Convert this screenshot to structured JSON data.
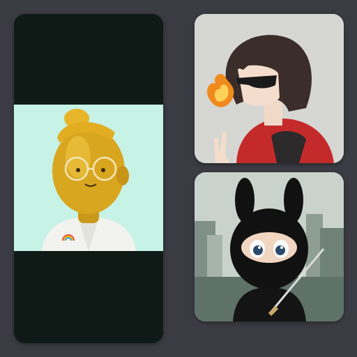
{
  "gallery": {
    "background": "#3b3b43",
    "items": [
      {
        "subject": "golden-character-with-glasses",
        "panel_color": "#c7f2e6",
        "frame_color": "#0f1a17"
      },
      {
        "subject": "anime-girl-sunglasses-fire",
        "panel_color": "#d6d6d2"
      },
      {
        "subject": "ninja-bunny-hood-city",
        "panel_color": "#c9d3cb"
      }
    ]
  }
}
